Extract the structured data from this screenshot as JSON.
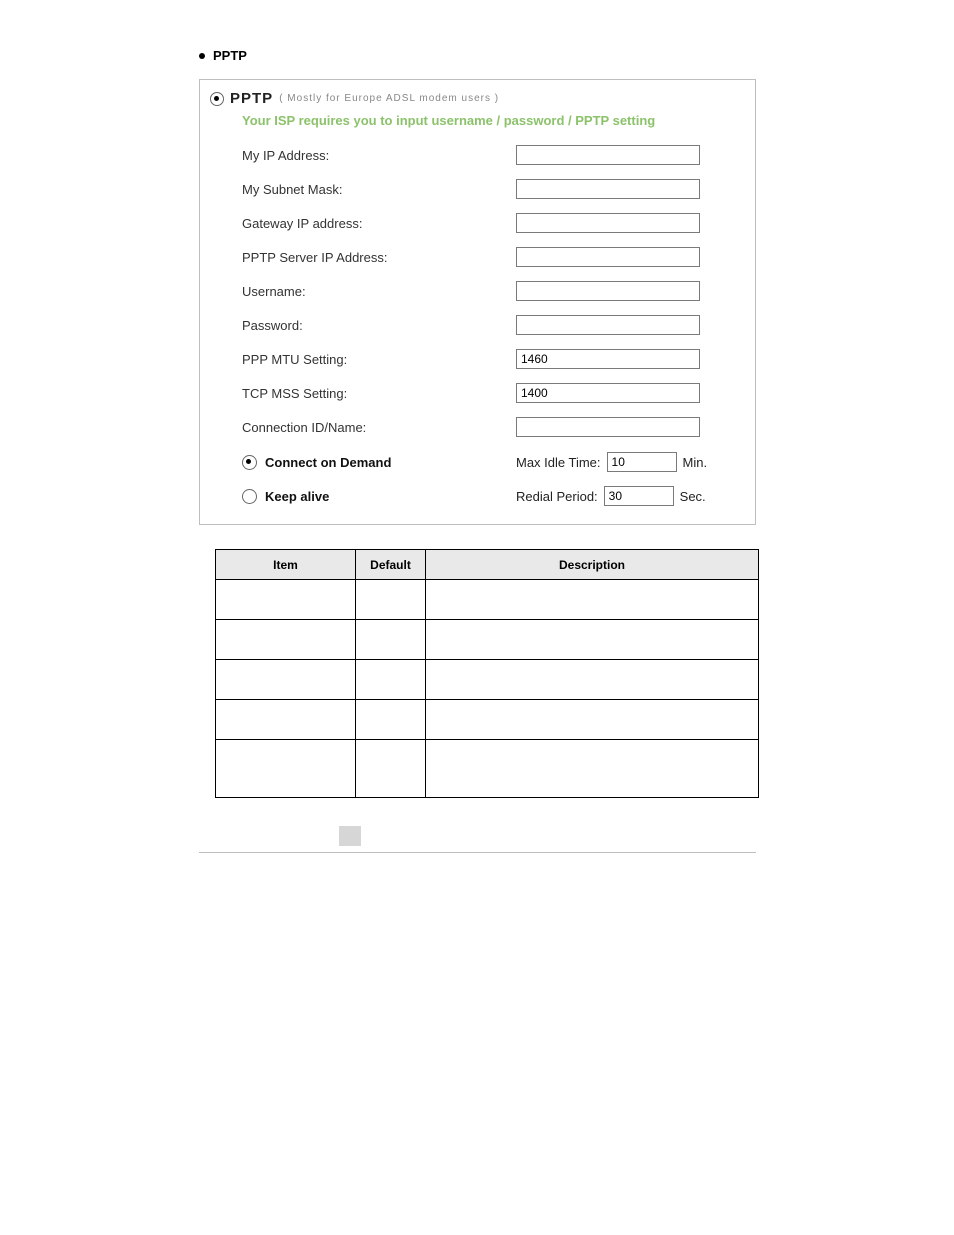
{
  "heading": "PPTP",
  "form": {
    "title": "PPTP",
    "subtitle": "( Mostly for Europe ADSL modem users )",
    "isp_line": "Your ISP requires you to input username / password / PPTP setting",
    "fields": {
      "my_ip_label": "My IP Address:",
      "my_ip_value": "",
      "subnet_label": "My Subnet Mask:",
      "subnet_value": "",
      "gateway_label": "Gateway IP address:",
      "gateway_value": "",
      "server_label": "PPTP Server IP Address:",
      "server_value": "",
      "user_label": "Username:",
      "user_value": "",
      "pass_label": "Password:",
      "pass_value": "",
      "mtu_label": "PPP MTU Setting:",
      "mtu_value": "1460",
      "mss_label": "TCP MSS Setting:",
      "mss_value": "1400",
      "conn_label": "Connection ID/Name:",
      "conn_value": ""
    },
    "options": {
      "cod_label": "Connect on Demand",
      "cod_right_label": "Max Idle Time:",
      "cod_value": "10",
      "cod_unit": "Min.",
      "ka_label": "Keep alive",
      "ka_right_label": "Redial Period:",
      "ka_value": "30",
      "ka_unit": "Sec."
    }
  },
  "table": {
    "headers": {
      "item": "Item",
      "default": "Default",
      "description": "Description"
    },
    "rows": [
      {
        "item": "",
        "default": "",
        "description": ""
      },
      {
        "item": "",
        "default": "",
        "description": ""
      },
      {
        "item": "",
        "default": "",
        "description": ""
      },
      {
        "item": "",
        "default": "",
        "description": ""
      },
      {
        "item": "",
        "default": "",
        "description": ""
      }
    ]
  },
  "page_number": ""
}
